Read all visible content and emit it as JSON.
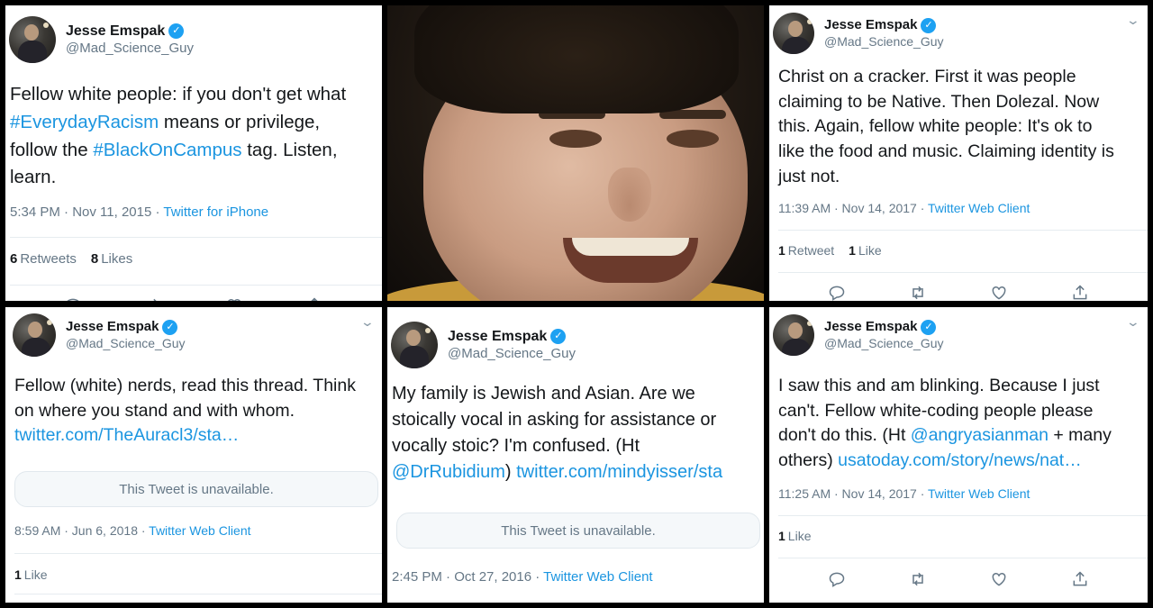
{
  "user": {
    "name": "Jesse Emspak",
    "handle": "@Mad_Science_Guy",
    "verified_icon": "verified-badge-icon"
  },
  "tweets": [
    {
      "text_parts": [
        "Fellow white people: if you don't get what",
        "#EverydayRacism",
        "means or privilege,",
        "follow the",
        "#BlackOnCampus",
        "tag. Listen,",
        "learn."
      ],
      "time": "5:34 PM · Nov 11, 2015 ·",
      "source": "Twitter for iPhone",
      "retweets_count": "6",
      "retweets_label": "Retweets",
      "likes_count": "8",
      "likes_label": "Likes"
    },
    {
      "text_lines": [
        "Christ on a cracker. First it was people",
        "claiming to be Native. Then Dolezal. Now",
        "this. Again, fellow white people: It's ok to",
        "like the food and music. Claiming identity is",
        "just not."
      ],
      "time": "11:39 AM · Nov 14, 2017 ·",
      "source": "Twitter Web Client",
      "retweets_count": "1",
      "retweets_label": "Retweet",
      "likes_count": "1",
      "likes_label": "Like"
    },
    {
      "text_lines": [
        "Fellow (white) nerds, read this thread. Think",
        "on where you stand and with whom."
      ],
      "link": "twitter.com/TheAuracl3/sta…",
      "quote": "This Tweet is unavailable.",
      "time": "8:59 AM · Jun 6, 2018 ·",
      "source": "Twitter Web Client",
      "likes_count": "1",
      "likes_label": "Like"
    },
    {
      "text_lines": [
        "My family is Jewish and Asian. Are we",
        "stoically vocal in asking for assistance or",
        "vocally stoic? I'm confused. (Ht"
      ],
      "mention": "@DrRubidium",
      "after_mention": ")",
      "link": "twitter.com/mindyisser/sta",
      "quote": "This Tweet is unavailable.",
      "time": "2:45 PM · Oct 27, 2016 ·",
      "source": "Twitter Web Client"
    },
    {
      "text_lines": [
        "I saw this and am blinking. Because I just",
        "can't. Fellow white-coding people please",
        "don't do this. (Ht"
      ],
      "mention": "@angryasianman",
      "after_mention": "+ many",
      "last_prefix": "others)",
      "link": "usatoday.com/story/news/nat…",
      "time": "11:25 AM · Nov 14, 2017 ·",
      "source": "Twitter Web Client",
      "likes_count": "1",
      "likes_label": "Like"
    }
  ],
  "icons": {
    "reply": "reply-icon",
    "retweet": "retweet-icon",
    "like": "heart-icon",
    "share": "share-icon",
    "more": "chevron-down-icon"
  },
  "colors": {
    "link": "#1b95e0",
    "verified": "#1da1f2",
    "muted": "#657786"
  }
}
